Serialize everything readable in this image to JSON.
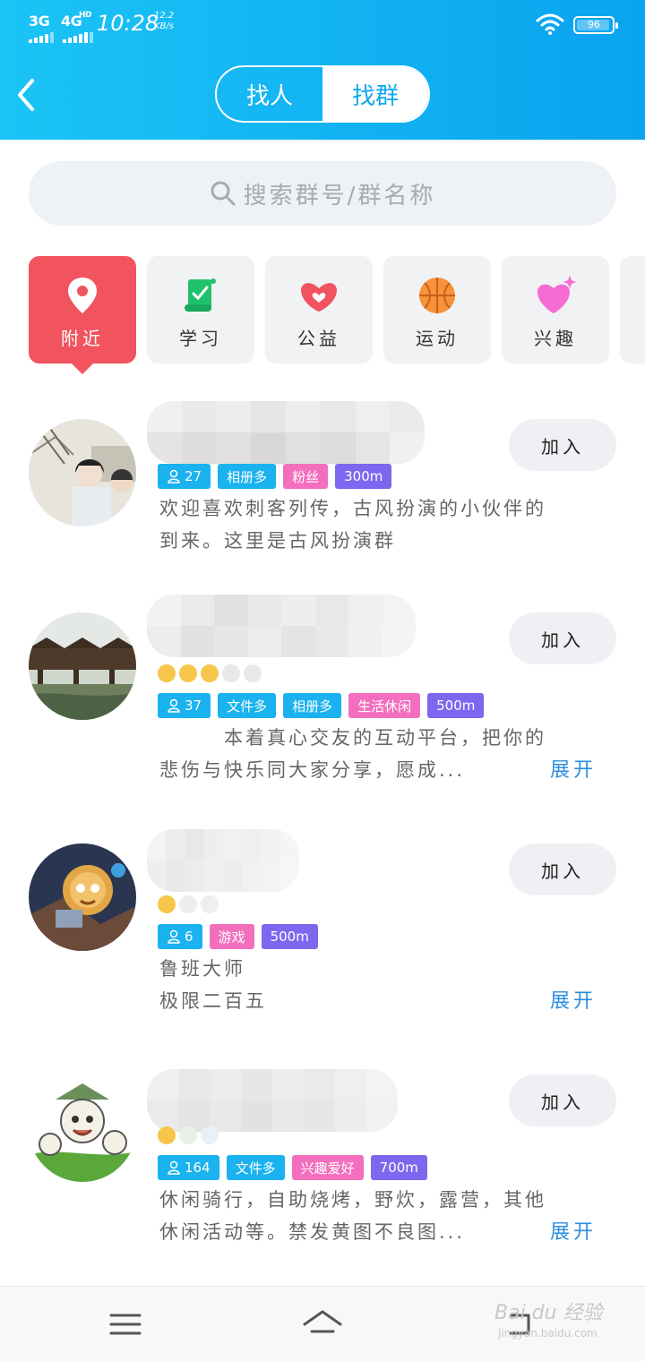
{
  "statusbar": {
    "network1": "3G",
    "network2": "4G",
    "network2_suffix": "HD",
    "time": "10:28",
    "speed_value": "12.2",
    "speed_unit": "KB/s",
    "battery": "96"
  },
  "header": {
    "tabs": [
      {
        "label": "找人",
        "active": false
      },
      {
        "label": "找群",
        "active": true
      }
    ]
  },
  "search": {
    "placeholder": "搜索群号/群名称"
  },
  "categories": [
    {
      "label": "附近",
      "icon": "location-pin-icon",
      "active": true
    },
    {
      "label": "学习",
      "icon": "scroll-icon",
      "active": false
    },
    {
      "label": "公益",
      "icon": "heart-hands-icon",
      "active": false
    },
    {
      "label": "运动",
      "icon": "basketball-icon",
      "active": false
    },
    {
      "label": "兴趣",
      "icon": "sparkle-heart-icon",
      "active": false
    }
  ],
  "groups": [
    {
      "join": "加入",
      "tags": [
        {
          "text": "27",
          "kind": "members"
        },
        {
          "text": "相册多",
          "kind": "blue"
        },
        {
          "text": "粉丝",
          "kind": "pink"
        },
        {
          "text": "300m",
          "kind": "purple"
        }
      ],
      "desc_line1": "欢迎喜欢刺客列传，古风扮演的小伙伴的",
      "desc_line2": "到来。这里是古风扮演群",
      "expand": ""
    },
    {
      "join": "加入",
      "tags": [
        {
          "text": "37",
          "kind": "members"
        },
        {
          "text": "文件多",
          "kind": "blue"
        },
        {
          "text": "相册多",
          "kind": "blue"
        },
        {
          "text": "生活休闲",
          "kind": "pink"
        },
        {
          "text": "500m",
          "kind": "purple"
        }
      ],
      "desc_line1": "　　　本着真心交友的互动平台，把你的",
      "desc_line2": "悲伤与快乐同大家分享，愿成...",
      "expand": "展开"
    },
    {
      "join": "加入",
      "tags": [
        {
          "text": "6",
          "kind": "members"
        },
        {
          "text": "游戏",
          "kind": "pink"
        },
        {
          "text": "500m",
          "kind": "purple"
        }
      ],
      "desc_line1": "鲁班大师",
      "desc_line2": "极限二百五",
      "expand": "展开"
    },
    {
      "join": "加入",
      "tags": [
        {
          "text": "164",
          "kind": "members"
        },
        {
          "text": "文件多",
          "kind": "blue"
        },
        {
          "text": "兴趣爱好",
          "kind": "pink"
        },
        {
          "text": "700m",
          "kind": "purple"
        }
      ],
      "desc_line1": " 休闲骑行，自助烧烤，野炊，露营，其他",
      "desc_line2": "休闲活动等。禁发黄图不良图...",
      "expand": "展开"
    }
  ],
  "watermark": {
    "brand": "Bai du 经验",
    "url": "jingyan.baidu.com"
  },
  "colors": {
    "header": "#11b0f2",
    "active_category": "#f1535f",
    "tag_blue": "#1ab2ef",
    "tag_pink": "#f36fbe",
    "tag_purple": "#7b68ee",
    "expand": "#2c8ee0"
  }
}
